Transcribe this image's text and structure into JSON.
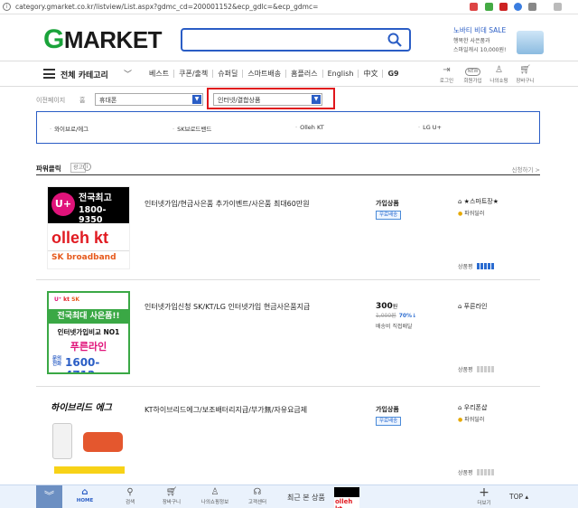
{
  "browser": {
    "url": "category.gmarket.co.kr/listview/List.aspx?gdmc_cd=200001152&ecp_gdlc=&ecp_gdmc="
  },
  "header": {
    "logo_g": "G",
    "logo_rest": "market",
    "search_placeholder": "",
    "promo": {
      "line1": "노바티 비데 SALE",
      "line2": "행복한 사은품과",
      "line3": "스마일캐시 10,000원!"
    }
  },
  "nav": {
    "all_categories": "전체 카테고리",
    "links": [
      "베스트",
      "쿠폰/출첵",
      "슈퍼딜",
      "스마트배송",
      "홈플러스",
      "English",
      "中文",
      "G9"
    ],
    "icons": [
      {
        "name": "login",
        "label": "로그인"
      },
      {
        "name": "signup",
        "label": "회원가입",
        "badge": "NEW"
      },
      {
        "name": "myshop",
        "label": "나의쇼핑"
      },
      {
        "name": "cart",
        "label": "장바구니"
      }
    ]
  },
  "breadcrumb": {
    "prev_page": "이전페이지",
    "home": "홈",
    "level1": "휴대폰",
    "level2": "인터넷/결합상품"
  },
  "subcategories": [
    "와이브로/에그",
    "SK브로드밴드",
    "Olleh KT",
    "LG U+"
  ],
  "power_click": {
    "title": "파워클릭",
    "ad_label": "광고",
    "apply": "신청하기 >"
  },
  "products": [
    {
      "title": "인터넷가입/현금사은품 추가이벤트/사은품 최대60만원",
      "price_label": "가입상품",
      "badge": "무료배송",
      "seller": "★스마트장★",
      "grade": "파워딜러",
      "rating_label": "상품평",
      "rating": 5,
      "thumb": {
        "line1": "전국최고",
        "line2": "1800-9350",
        "line3": "olleh kt",
        "line4": "SK broadband"
      }
    },
    {
      "title": "인터넷가입신청 SK/KT/LG 인터넷가입 현금사은품지급",
      "price": "300",
      "price_unit": "원",
      "orig_price": "1,000원",
      "discount": "70%↓",
      "shipping": "배송비 직접배달",
      "seller": "푸른라인",
      "rating_label": "상품평",
      "rating": 0,
      "thumb": {
        "line1": "전국최대 사은품!!",
        "line2": "인터넷가입비교 NO1",
        "line3": "푸른라인",
        "line4": "1600-4712",
        "ask": "문의전화"
      }
    },
    {
      "title": "KT하이브리드에그/보조배터리지급/부가無/자유요금제",
      "price_label": "가입상품",
      "badge": "무료배송",
      "seller": "우리폰샵",
      "grade": "파워딜러",
      "rating_label": "상품평",
      "rating": 0,
      "thumb": {
        "line1": "하이브리드 에그"
      }
    }
  ],
  "bottom_bar": {
    "items": [
      "HOME",
      "검색",
      "장바구니",
      "나의쇼핑정보",
      "고객센터"
    ],
    "recent": "최근 본 상품",
    "more": "더보기",
    "top": "TOP"
  },
  "colors": {
    "accent": "#2a5dc5",
    "brand_green": "#1aa33a",
    "highlight": "#e0161b"
  }
}
